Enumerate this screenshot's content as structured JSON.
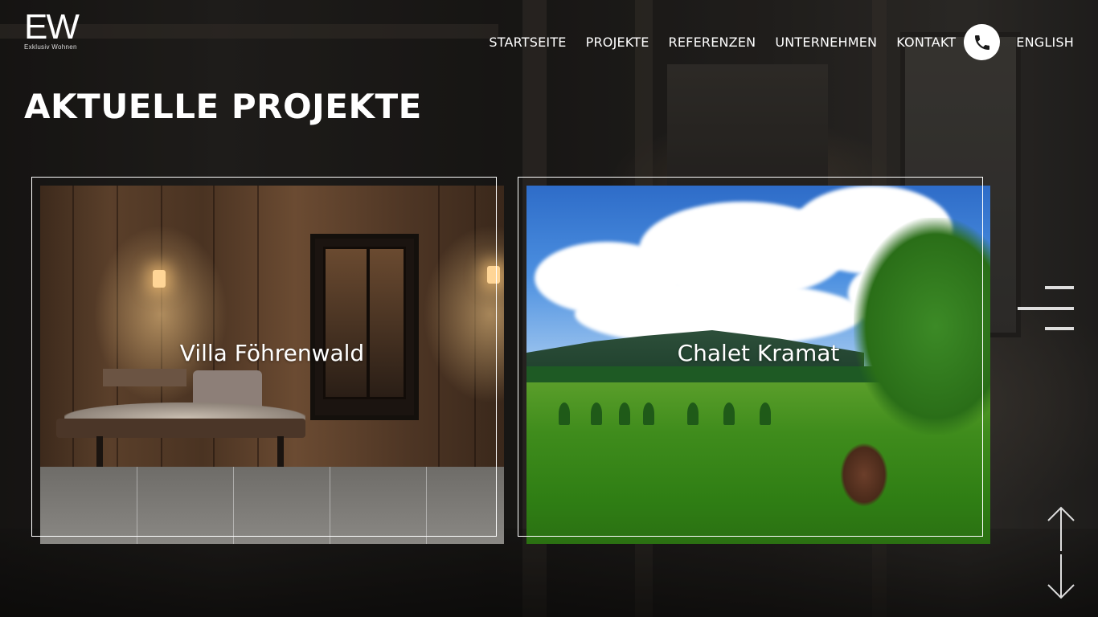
{
  "brand": {
    "logo_mark": "EW",
    "logo_sub": "Exklusiv Wohnen"
  },
  "nav": {
    "items": [
      {
        "label": "STARTSEITE"
      },
      {
        "label": "PROJEKTE"
      },
      {
        "label": "REFERENZEN"
      },
      {
        "label": "UNTERNEHMEN"
      },
      {
        "label": "KONTAKT"
      }
    ],
    "phone_icon": "phone-icon",
    "language_label": "ENGLISH"
  },
  "main": {
    "title": "AKTUELLE PROJEKTE",
    "projects": [
      {
        "name": "Villa Föhrenwald"
      },
      {
        "name": "Chalet Kramat"
      }
    ]
  },
  "controls": {
    "menu_icon": "hamburger-menu-icon",
    "scroll_icon": "up-down-arrows-icon"
  },
  "colors": {
    "text": "#ffffff",
    "phone_button_bg": "#ffffff",
    "phone_icon": "#1a1a1a"
  }
}
